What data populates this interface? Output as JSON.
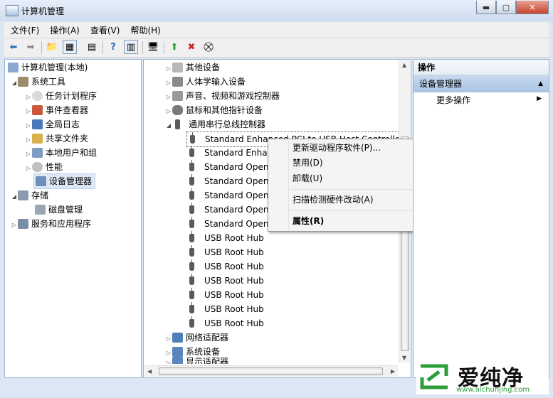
{
  "window": {
    "title": "计算机管理"
  },
  "menubar": [
    "文件(F)",
    "操作(A)",
    "查看(V)",
    "帮助(H)"
  ],
  "tree": {
    "root": "计算机管理(本地)",
    "system_tools": "系统工具",
    "task_scheduler": "任务计划程序",
    "event_viewer": "事件查看器",
    "global_log": "全局日志",
    "shared_folders": "共享文件夹",
    "local_users": "本地用户和组",
    "performance": "性能",
    "device_manager": "设备管理器",
    "storage": "存储",
    "disk_management": "磁盘管理",
    "services_apps": "服务和应用程序"
  },
  "devices": {
    "other": "其他设备",
    "hid": "人体学输入设备",
    "audio": "声音、视频和游戏控制器",
    "mouse": "鼠标和其他指针设备",
    "usb_controllers": "通用串行总线控制器",
    "usb_items": [
      "Standard Enhanced PCI to USB Host Controller",
      "Standard Enhan",
      "Standard Openl",
      "Standard Openl",
      "Standard Openl",
      "Standard Openl",
      "Standard Openl",
      "USB Root Hub",
      "USB Root Hub",
      "USB Root Hub",
      "USB Root Hub",
      "USB Root Hub",
      "USB Root Hub",
      "USB Root Hub"
    ],
    "network": "网络适配器",
    "system": "系统设备",
    "display": "显示适配器"
  },
  "context_menu": {
    "update_driver": "更新驱动程序软件(P)...",
    "disable": "禁用(D)",
    "uninstall": "卸载(U)",
    "scan": "扫描检测硬件改动(A)",
    "properties": "属性(R)"
  },
  "actions": {
    "header": "操作",
    "section": "设备管理器",
    "more": "更多操作"
  },
  "watermark": {
    "brand": "爱纯净",
    "url": "www.aichunjing.com"
  },
  "colors": {
    "accent": "#2f6fb5",
    "section_bg": "#aac4e4",
    "logo_green": "#2e9e3a"
  }
}
